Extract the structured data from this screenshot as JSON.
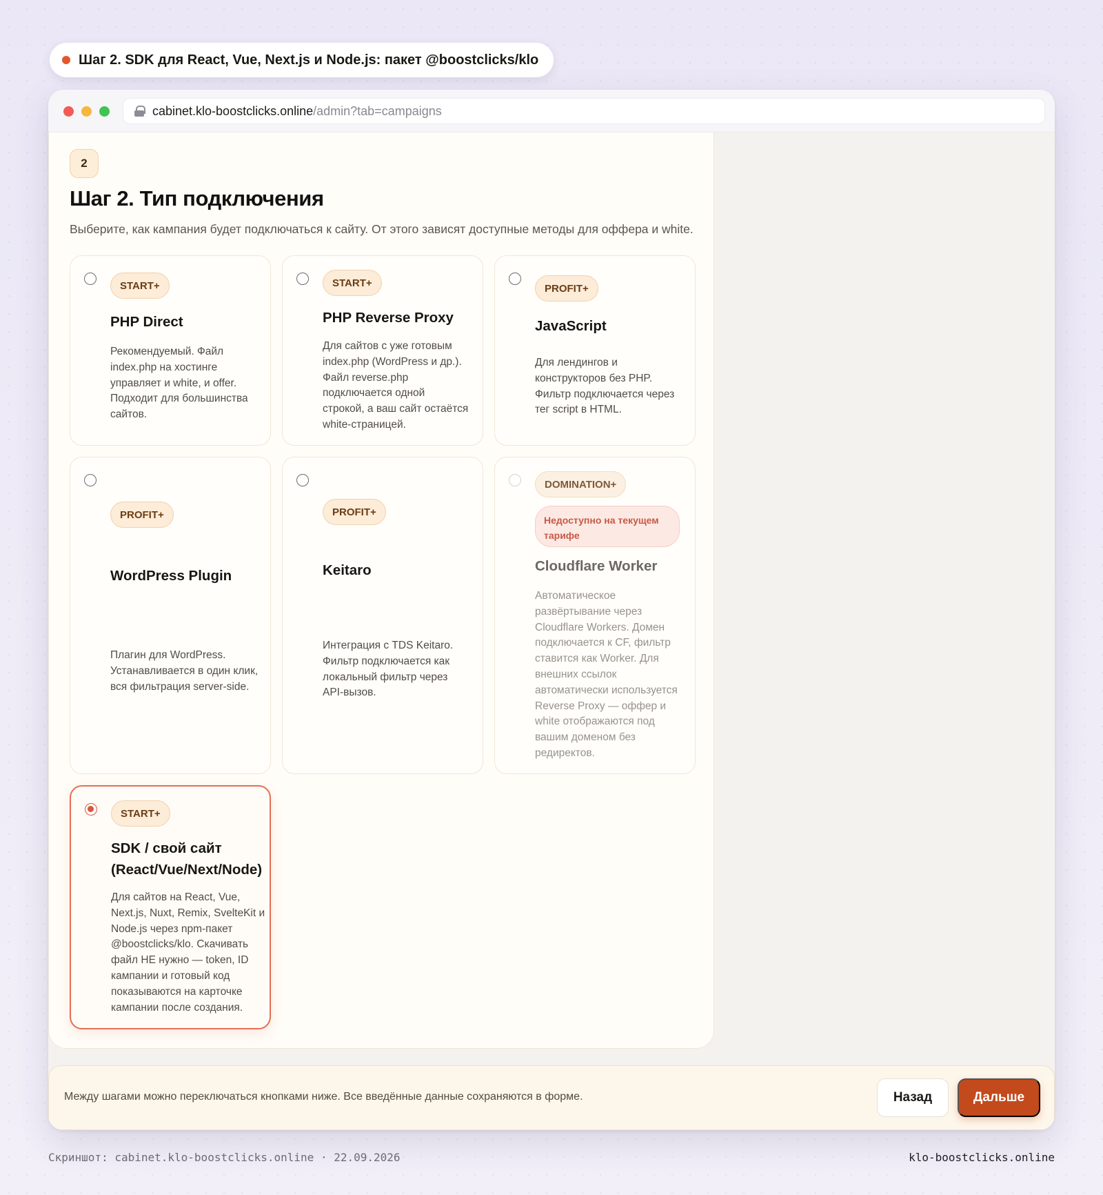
{
  "step_pill": {
    "text": "Шаг 2. SDK для React, Vue, Next.js и Node.js: пакет @boostclicks/klo",
    "dot_color": "#e2572a"
  },
  "browser": {
    "url_host": "cabinet.klo-boostclicks.online",
    "url_path": "/admin?tab=campaigns"
  },
  "panel": {
    "step_number": "2",
    "title": "Шаг 2. Тип подключения",
    "subtitle": "Выберите, как кампания будет подключаться к сайту. От этого зависят доступные методы для оффера и white."
  },
  "cards": [
    {
      "tier": "START+",
      "title_lines": [
        "PHP Direct"
      ],
      "desc_lines": [
        "Рекомендуемый. Файл",
        "index.php на хостинге",
        "управляет и white, и offer.",
        "Подходит для большинства",
        "сайтов."
      ],
      "selected": false
    },
    {
      "tier": "START+",
      "title_lines": [
        "PHP Reverse Proxy"
      ],
      "desc_lines": [
        "Для сайтов с уже готовым",
        "index.php (WordPress и др.).",
        "Файл reverse.php",
        "подключается одной",
        "строкой, а ваш сайт остаётся",
        "white-страницей."
      ],
      "selected": false
    },
    {
      "tier": "PROFIT+",
      "title_lines": [
        "JavaScript"
      ],
      "desc_lines": [
        "Для лендингов и",
        "конструкторов без PHP.",
        "Фильтр подключается через",
        "тег script в HTML."
      ],
      "selected": false
    },
    {
      "tier": "PROFIT+",
      "title_lines": [
        "WordPress Plugin"
      ],
      "desc_lines": [
        "Плагин для WordPress.",
        "Устанавливается в один клик,",
        "вся фильтрация server-side."
      ],
      "selected": false
    },
    {
      "tier": "PROFIT+",
      "title_lines": [
        "Keitaro"
      ],
      "desc_lines": [
        "Интеграция с TDS Keitaro.",
        "Фильтр подключается как",
        "локальный фильтр через",
        "API-вызов."
      ],
      "selected": false
    },
    {
      "tier": "DOMINATION+",
      "unavailable_lines": [
        "Недоступно на текущем",
        "тарифе"
      ],
      "title_lines": [
        "Cloudflare Worker"
      ],
      "desc_lines": [
        "Автоматическое",
        "развёртывание через",
        "Cloudflare Workers. Домен",
        "подключается к CF, фильтр",
        "ставится как Worker. Для",
        "внешних ссылок",
        "автоматически используется",
        "Reverse Proxy — оффер и",
        "white отображаются под",
        "вашим доменом без",
        "редиректов."
      ],
      "selected": false,
      "disabled": true
    },
    {
      "tier": "START+",
      "title_lines": [
        "SDK / свой сайт",
        "(React/Vue/Next/Node)"
      ],
      "desc_lines": [
        "Для сайтов на React, Vue,",
        "Next.js, Nuxt, Remix, SvelteKit и",
        "Node.js через npm-пакет",
        "@boostclicks/klo. Скачивать",
        "файл НЕ нужно — token, ID",
        "кампании и готовый код",
        "показываются на карточке",
        "кампании после создания."
      ],
      "selected": true
    }
  ],
  "bottom_bar": {
    "text": "Между шагами можно переключаться кнопками ниже. Все введённые данные сохраняются в форме.",
    "back_label": "Назад",
    "next_label": "Дальше",
    "next_color": "#c24a1c"
  },
  "footer": {
    "left": "Скриншот: cabinet.klo-boostclicks.online · 22.09.2026",
    "right": "klo-boostclicks.online"
  }
}
